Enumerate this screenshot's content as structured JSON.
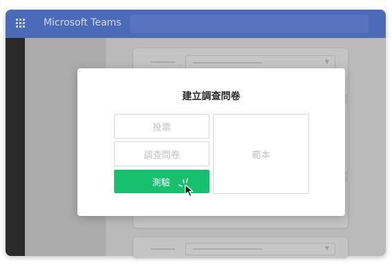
{
  "app": {
    "title": "Microsoft Teams",
    "grid_icon": "app-launcher-grid-icon"
  },
  "dialog": {
    "title": "建立調查問卷",
    "options": {
      "poll": "投票",
      "survey": "調查問卷",
      "quiz": "測驗",
      "template": "範本"
    },
    "selected": "quiz",
    "cursor_icon": "pointer-click-icon"
  },
  "colors": {
    "titlebar": "#4b6ab8",
    "accent_green": "#16c06c",
    "overlay_gray": "#b9b9b9"
  }
}
